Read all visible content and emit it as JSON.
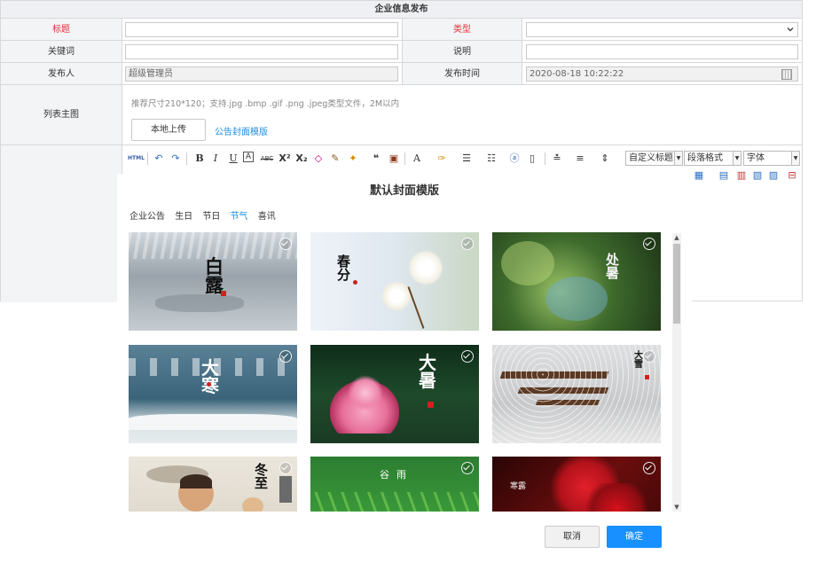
{
  "form": {
    "header": "企业信息发布",
    "title_label": "标题",
    "type_label": "类型",
    "keywords_label": "关键词",
    "desc_label": "说明",
    "publisher_label": "发布人",
    "publisher_value": "超级管理员",
    "publish_time_label": "发布时间",
    "publish_time_value": "2020-08-18 10:22:22",
    "image_label": "列表主图",
    "image_hint": "推荐尺寸210*120；支持.jpg .bmp .gif .png .jpeg类型文件，2M以内",
    "upload_button": "本地上传",
    "template_link": "公告封面模版",
    "required_color": "#e0333b"
  },
  "editor": {
    "html_label": "HTML",
    "custom_title": "自定义标题",
    "paragraph_format": "段落格式",
    "font": "字体",
    "icons": [
      "undo-icon",
      "redo-icon",
      "bold-icon",
      "italic-icon",
      "underline-icon",
      "border-icon",
      "strikethrough-icon",
      "superscript-icon",
      "subscript-icon",
      "eraser-icon",
      "format-brush-icon",
      "auto-format-icon",
      "quote-icon",
      "paste-text-icon",
      "font-color-icon",
      "highlight-icon",
      "ordered-list-icon",
      "unordered-list-icon",
      "select-all-icon",
      "clear-doc-icon",
      "line-height-icon",
      "paragraph-spacing-icon",
      "row-spacing-icon"
    ]
  },
  "modal": {
    "title": "默认封面模版",
    "tabs": [
      {
        "label": "企业公告"
      },
      {
        "label": "生日"
      },
      {
        "label": "节日"
      },
      {
        "label": "节气"
      },
      {
        "label": "喜讯"
      }
    ],
    "active_tab": "节气",
    "cards": [
      {
        "label": "白露",
        "bg": "#b5bcc3"
      },
      {
        "label": "春分",
        "bg": "#e9eef4"
      },
      {
        "label": "处暑",
        "bg": "#3f6b2c"
      },
      {
        "label": "大寒",
        "bg": "#40697f"
      },
      {
        "label": "大暑",
        "bg": "#1e4a2a"
      },
      {
        "label": "大雪",
        "bg": "#cfcfd0"
      },
      {
        "label": "冬至",
        "bg": "#e3ddd2"
      },
      {
        "label": "谷雨",
        "bg": "#2d7a2e"
      },
      {
        "label": "寒露",
        "bg": "#6a0d0d"
      }
    ],
    "cancel": "取消",
    "ok": "确定",
    "accent": "#1890ff"
  }
}
